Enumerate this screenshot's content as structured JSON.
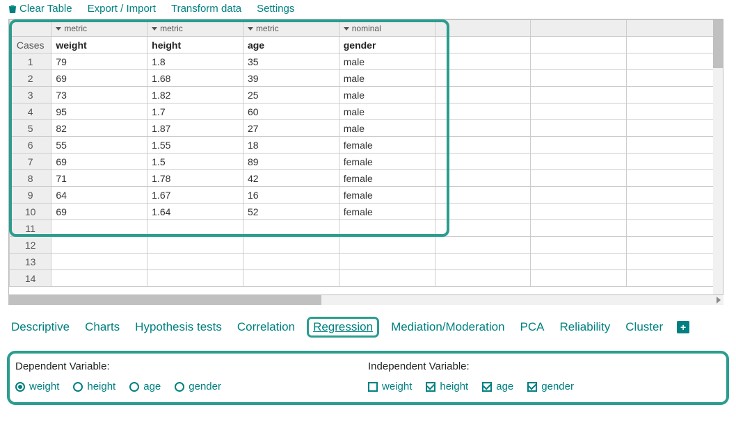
{
  "toolbar": {
    "clear": "Clear Table",
    "export_import": "Export / Import",
    "transform": "Transform data",
    "settings": "Settings"
  },
  "table": {
    "cases_label": "Cases",
    "types": [
      "metric",
      "metric",
      "metric",
      "nominal"
    ],
    "vars": [
      "weight",
      "height",
      "age",
      "gender"
    ],
    "rows": [
      {
        "n": "1",
        "cells": [
          "79",
          "1.8",
          "35",
          "male"
        ]
      },
      {
        "n": "2",
        "cells": [
          "69",
          "1.68",
          "39",
          "male"
        ]
      },
      {
        "n": "3",
        "cells": [
          "73",
          "1.82",
          "25",
          "male"
        ]
      },
      {
        "n": "4",
        "cells": [
          "95",
          "1.7",
          "60",
          "male"
        ]
      },
      {
        "n": "5",
        "cells": [
          "82",
          "1.87",
          "27",
          "male"
        ]
      },
      {
        "n": "6",
        "cells": [
          "55",
          "1.55",
          "18",
          "female"
        ]
      },
      {
        "n": "7",
        "cells": [
          "69",
          "1.5",
          "89",
          "female"
        ]
      },
      {
        "n": "8",
        "cells": [
          "71",
          "1.78",
          "42",
          "female"
        ]
      },
      {
        "n": "9",
        "cells": [
          "64",
          "1.67",
          "16",
          "female"
        ]
      },
      {
        "n": "10",
        "cells": [
          "69",
          "1.64",
          "52",
          "female"
        ]
      },
      {
        "n": "11",
        "cells": [
          "",
          "",
          "",
          ""
        ]
      },
      {
        "n": "12",
        "cells": [
          "",
          "",
          "",
          ""
        ]
      },
      {
        "n": "13",
        "cells": [
          "",
          "",
          "",
          ""
        ]
      },
      {
        "n": "14",
        "cells": [
          "",
          "",
          "",
          ""
        ]
      }
    ],
    "extra_blank_cols": 3
  },
  "tabs": {
    "items": [
      "Descriptive",
      "Charts",
      "Hypothesis tests",
      "Correlation",
      "Regression",
      "Mediation/Moderation",
      "PCA",
      "Reliability",
      "Cluster"
    ],
    "active_index": 4
  },
  "vars_panel": {
    "dep_title": "Dependent Variable:",
    "indep_title": "Independent Variable:",
    "dep_options": [
      {
        "label": "weight",
        "selected": true
      },
      {
        "label": "height",
        "selected": false
      },
      {
        "label": "age",
        "selected": false
      },
      {
        "label": "gender",
        "selected": false
      }
    ],
    "indep_options": [
      {
        "label": "weight",
        "selected": false
      },
      {
        "label": "height",
        "selected": true
      },
      {
        "label": "age",
        "selected": true
      },
      {
        "label": "gender",
        "selected": true
      }
    ]
  }
}
